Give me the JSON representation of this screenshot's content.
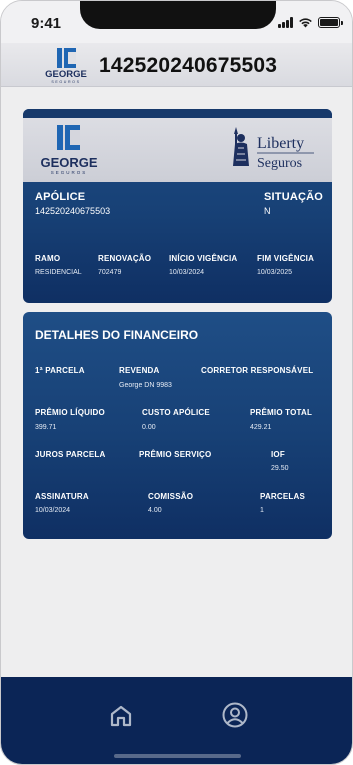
{
  "status_bar": {
    "time": "9:41"
  },
  "header": {
    "policy_number": "142520240675503",
    "logo_word": "GEORGE",
    "logo_sub": "SEGUROS"
  },
  "policy_card": {
    "george_logo": {
      "word": "GEORGE",
      "sub": "SEGUROS"
    },
    "liberty_logo": {
      "line1": "Liberty",
      "line2": "Seguros"
    },
    "apolice_label": "APÓLICE",
    "apolice_value": "142520240675503",
    "situacao_label": "SITUAÇÃO",
    "situacao_value": "N",
    "ramo_label": "RAMO",
    "ramo_value": "RESIDENCIAL",
    "renovacao_label": "RENOVAÇÃO",
    "renovacao_value": "702479",
    "inicio_label": "INÍCIO VIGÊNCIA",
    "inicio_value": "10/03/2024",
    "fim_label": "FIM VIGÊNCIA",
    "fim_value": "10/03/2025"
  },
  "finance_card": {
    "title": "DETALHES DO FINANCEIRO",
    "parcela_label": "1ª PARCELA",
    "revenda_label": "REVENDA",
    "revenda_value": "George DN 9983",
    "corretor_label": "CORRETOR RESPONSÁVEL",
    "premio_liquido_label": "PRÊMIO LÍQUIDO",
    "premio_liquido_value": "399.71",
    "custo_apolice_label": "CUSTO APÓLICE",
    "custo_apolice_value": "0.00",
    "premio_total_label": "PRÊMIO TOTAL",
    "premio_total_value": "429.21",
    "juros_label": "JUROS PARCELA",
    "premio_servico_label": "PRÊMIO SERVIÇO",
    "iof_label": "IOF",
    "iof_value": "29.50",
    "assinatura_label": "ASSINATURA",
    "assinatura_value": "10/03/2024",
    "comissao_label": "COMISSÃO",
    "comissao_value": "4.00",
    "parcelas_label": "PARCELAS",
    "parcelas_value": "1"
  },
  "bottom_nav": {
    "items": [
      "home-icon",
      "profile-icon"
    ]
  },
  "colors": {
    "card_blue": "#174075",
    "nav_dark": "#0b2556",
    "george_blue": "#1f66b3",
    "george_navy": "#1d2f5e"
  }
}
